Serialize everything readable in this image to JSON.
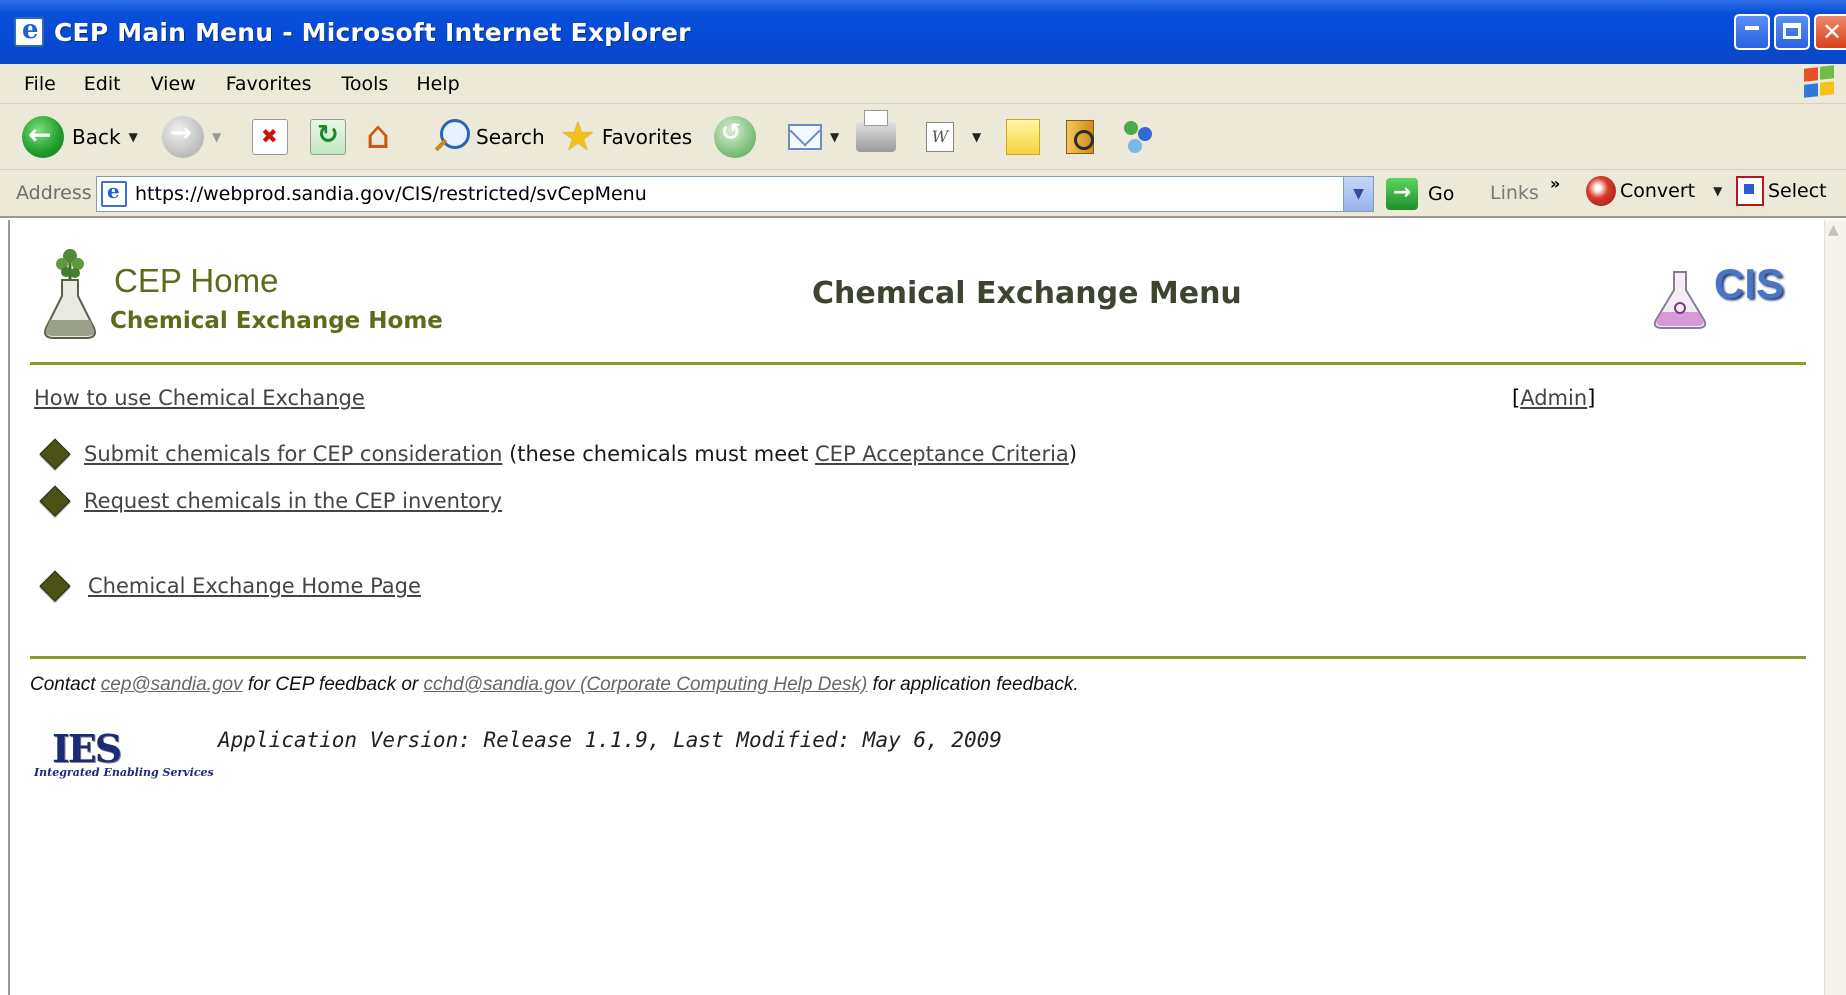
{
  "window": {
    "title": "CEP Main Menu - Microsoft Internet Explorer"
  },
  "menubar": {
    "items": [
      "File",
      "Edit",
      "View",
      "Favorites",
      "Tools",
      "Help"
    ]
  },
  "toolbar": {
    "back_label": "Back",
    "search_label": "Search",
    "favorites_label": "Favorites",
    "word_icon_label": "W"
  },
  "addressbar": {
    "label": "Address",
    "url": "https://webprod.sandia.gov/CIS/restricted/svCepMenu",
    "go_label": "Go",
    "links_label": "Links",
    "links_chevron": "»",
    "convert_label": "Convert",
    "select_label": "Select"
  },
  "page": {
    "home_title": "CEP Home",
    "home_subtitle": "Chemical Exchange Home",
    "heading": "Chemical Exchange Menu",
    "cis_logo_text": "CIS",
    "how_to_link": "How to use Chemical Exchange",
    "admin_open": "[",
    "admin_link": "Admin",
    "admin_close": "]",
    "submit_link": "Submit chemicals for CEP consideration",
    "submit_note_before": " (these chemicals must meet ",
    "criteria_link": "CEP Acceptance Criteria",
    "submit_note_after": ")",
    "request_link": "Request chemicals in the CEP inventory",
    "home_page_link": "Chemical Exchange Home Page"
  },
  "footer": {
    "contact_prefix": "Contact ",
    "cep_email": "cep@sandia.gov",
    "contact_middle": " for CEP feedback or ",
    "help_desk_link": "cchd@sandia.gov (Corporate Computing Help Desk)",
    "contact_suffix": " for application feedback.",
    "ies_logo_text": "IES",
    "ies_logo_subtext": "Integrated Enabling Services",
    "version": "Application Version: Release 1.1.9, Last Modified: May 6, 2009"
  },
  "colors": {
    "accent": "#8c9a2a",
    "bullet": "#4c5215",
    "title_bar": "#0549d6"
  }
}
